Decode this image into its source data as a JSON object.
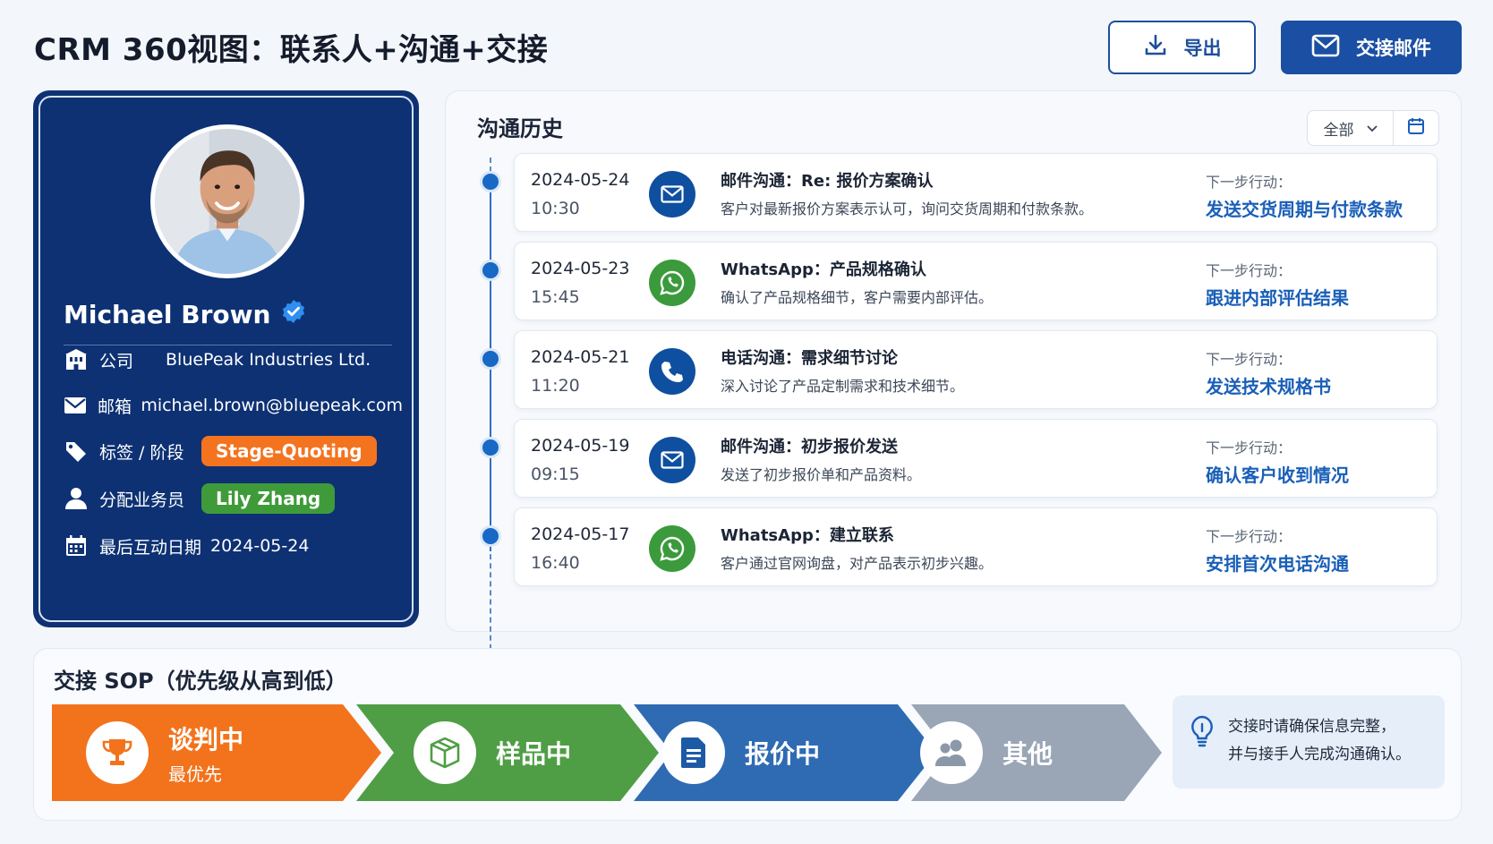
{
  "header": {
    "title": "CRM 360视图：联系人+沟通+交接",
    "export_label": "导出",
    "handover_label": "交接邮件"
  },
  "profile": {
    "name": "Michael Brown",
    "rows": [
      {
        "icon": "building-icon",
        "label": "公司",
        "value": "BluePeak Industries Ltd."
      },
      {
        "icon": "mail-icon",
        "label": "邮箱",
        "value": "michael.brown@bluepeak.com"
      },
      {
        "icon": "tag-icon",
        "label": "标签 / 阶段",
        "value": "Stage-Quoting"
      },
      {
        "icon": "user-icon",
        "label": "分配业务员",
        "value": "Lily Zhang"
      },
      {
        "icon": "calendar-icon",
        "label": "最后互动日期",
        "value": "2024-05-24"
      }
    ]
  },
  "history": {
    "title": "沟通历史",
    "filter_value": "全部",
    "next_label": "下一步行动：",
    "items": [
      {
        "date": "2024-05-24",
        "time": "10:30",
        "channel": "mail-icon",
        "subject": "邮件沟通：Re: 报价方案确认",
        "desc": "客户对最新报价方案表示认可，询问交货周期和付款条款。",
        "next": "发送交货周期与付款条款"
      },
      {
        "date": "2024-05-23",
        "time": "15:45",
        "channel": "whatsapp-icon",
        "subject": "WhatsApp：产品规格确认",
        "desc": "确认了产品规格细节，客户需要内部评估。",
        "next": "跟进内部评估结果"
      },
      {
        "date": "2024-05-21",
        "time": "11:20",
        "channel": "phone-icon",
        "subject": "电话沟通：需求细节讨论",
        "desc": "深入讨论了产品定制需求和技术细节。",
        "next": "发送技术规格书"
      },
      {
        "date": "2024-05-19",
        "time": "09:15",
        "channel": "mail-icon",
        "subject": "邮件沟通：初步报价发送",
        "desc": "发送了初步报价单和产品资料。",
        "next": "确认客户收到情况"
      },
      {
        "date": "2024-05-17",
        "time": "16:40",
        "channel": "whatsapp-icon",
        "subject": "WhatsApp：建立联系",
        "desc": "客户通过官网询盘，对产品表示初步兴趣。",
        "next": "安排首次电话沟通"
      }
    ]
  },
  "sop": {
    "title": "交接 SOP（优先级从高到低）",
    "steps": [
      {
        "label": "谈判中",
        "sub": "最优先",
        "icon": "trophy-icon",
        "color": "#f2731c"
      },
      {
        "label": "样品中",
        "sub": "",
        "icon": "box-icon",
        "color": "#4f9e45"
      },
      {
        "label": "报价中",
        "sub": "",
        "icon": "document-icon",
        "color": "#2f6bb3"
      },
      {
        "label": "其他",
        "sub": "",
        "icon": "users-icon",
        "color": "#9aa6b6"
      }
    ],
    "note_line1": "交接时请确保信息完整，",
    "note_line2": "并与接手人完成沟通确认。"
  }
}
